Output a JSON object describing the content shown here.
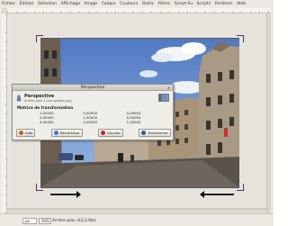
{
  "menubar": {
    "items": [
      "Fichier",
      "Édition",
      "Sélection",
      "Affichage",
      "Image",
      "Calque",
      "Couleurs",
      "Outils",
      "Filtres",
      "Script-Fu",
      "Scripts",
      "Fenêtres",
      "Aide"
    ]
  },
  "dialog": {
    "title": "Perspective",
    "tool_name": "Perspective",
    "subtitle": "Arrière-plan-1 (rue-quebec.jpg)",
    "matrix_label": "Matrice de transformation",
    "matrix": [
      [
        "1,00000",
        "0,00000",
        "0,00000"
      ],
      [
        "0,00000",
        "1,00000",
        "0,00000"
      ],
      [
        "0,00000",
        "0,00000",
        "1,00000"
      ]
    ],
    "buttons": {
      "help": "Aide",
      "reset": "Réinitialiser",
      "cancel": "Annuler",
      "transform": "Transformer"
    },
    "button_colors": {
      "help": "#d85a1a",
      "reset": "#3a7bd5",
      "cancel": "#cc2222",
      "transform": "#2a5aa8"
    }
  },
  "statusbar": {
    "unit": "px",
    "zoom": "50%",
    "text": "Arrière-plan (43,3 Mo)"
  }
}
